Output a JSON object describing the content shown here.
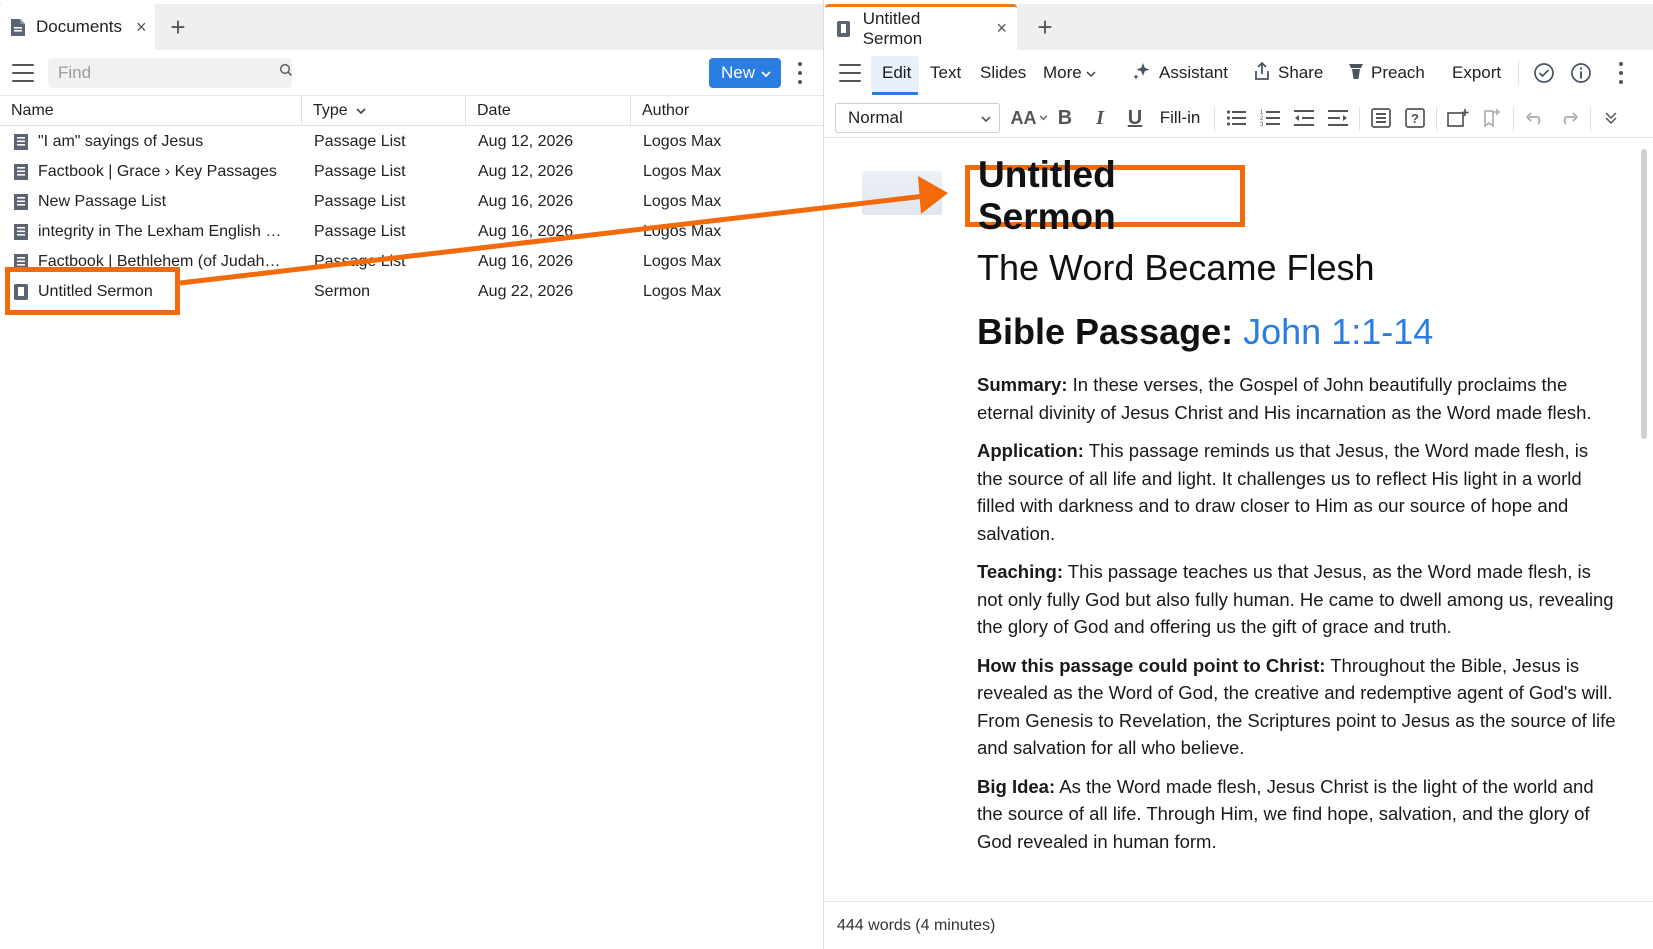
{
  "left_pane": {
    "tab": {
      "label": "Documents",
      "close": "×",
      "add": "+"
    },
    "search": {
      "placeholder": "Find"
    },
    "new_button": {
      "label": "New"
    },
    "columns": {
      "name": "Name",
      "type": "Type",
      "date": "Date",
      "author": "Author"
    },
    "rows": [
      {
        "name": "\"I am\" sayings of Jesus",
        "type": "Passage List",
        "date": "Aug 12, 2026",
        "author": "Logos Max",
        "icon": "passage-list-icon"
      },
      {
        "name": "Factbook | Grace › Key Passages",
        "type": "Passage List",
        "date": "Aug 12, 2026",
        "author": "Logos Max",
        "icon": "passage-list-icon"
      },
      {
        "name": "New Passage List",
        "type": "Passage List",
        "date": "Aug 16, 2026",
        "author": "Logos Max",
        "icon": "passage-list-icon"
      },
      {
        "name": "integrity in The Lexham English …",
        "type": "Passage List",
        "date": "Aug 16, 2026",
        "author": "Logos Max",
        "icon": "passage-list-icon"
      },
      {
        "name": "Factbook | Bethlehem (of Judah…",
        "type": "Passage List",
        "date": "Aug 16, 2026",
        "author": "Logos Max",
        "icon": "passage-list-icon"
      },
      {
        "name": "Untitled Sermon",
        "type": "Sermon",
        "date": "Aug 22, 2026",
        "author": "Logos Max",
        "icon": "sermon-icon"
      }
    ]
  },
  "right_pane": {
    "tab": {
      "label": "Untitled Sermon",
      "close": "×",
      "add": "+"
    },
    "toolbar": {
      "edit": "Edit",
      "text": "Text",
      "slides": "Slides",
      "more": "More",
      "assistant": "Assistant",
      "share": "Share",
      "preach": "Preach",
      "export": "Export"
    },
    "format_bar": {
      "style": "Normal",
      "fill_in": "Fill-in",
      "font_size_glyph": "AA",
      "bold": "B",
      "italic": "I",
      "underline": "U"
    },
    "document": {
      "title": "Untitled Sermon",
      "subtitle": "The Word Became Flesh",
      "passage_label": "Bible Passage:",
      "passage_ref": "John 1:1-14",
      "sections": [
        {
          "label": "Summary:",
          "text": " In these verses, the Gospel of John beautifully proclaims the eternal divinity of Jesus Christ and His incarnation as the Word made flesh."
        },
        {
          "label": "Application:",
          "text": " This passage reminds us that Jesus, the Word made flesh, is the source of all life and light. It challenges us to reflect His light in a world filled with darkness and to draw closer to Him as our source of hope and salvation."
        },
        {
          "label": "Teaching:",
          "text": " This passage teaches us that Jesus, as the Word made flesh, is not only fully God but also fully human. He came to dwell among us, revealing the glory of God and offering us the gift of grace and truth."
        },
        {
          "label": "How this passage could point to Christ:",
          "text": " Throughout the Bible, Jesus is revealed as the Word of God, the creative and redemptive agent of God's will. From Genesis to Revelation, the Scriptures point to Jesus as the source of life and salvation for all who believe."
        },
        {
          "label": "Big Idea:",
          "text": " As the Word made flesh, Jesus Christ is the light of the world and the source of all life. Through Him, we find hope, salvation, and the glory of God revealed in human form."
        }
      ]
    },
    "status": "444 words (4 minutes)"
  },
  "colors": {
    "accent_blue": "#2a7de1",
    "callout_orange": "#f26a0a",
    "tab_active_orange": "#f07a17"
  }
}
